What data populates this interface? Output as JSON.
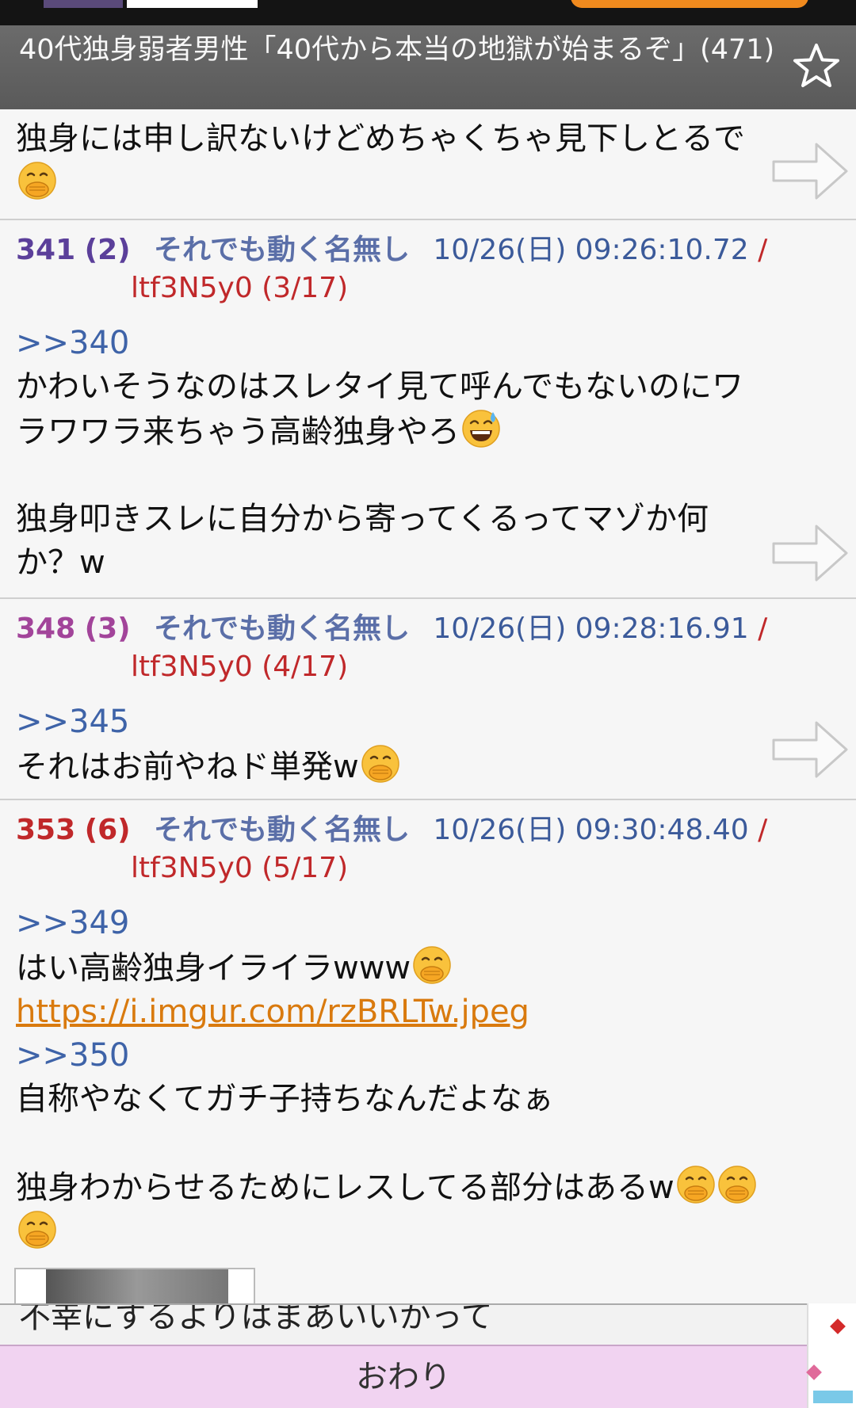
{
  "thread": {
    "title": "40代独身弱者男性「40代から本当の地獄が始まるぞ」(471)"
  },
  "partial_post": {
    "lines": [
      "独身には申し訳ないけどめちゃくちゃ見下しとるで"
    ]
  },
  "posts": [
    {
      "number": "341",
      "count": "(2)",
      "name": "それでも動く名無し",
      "date": "10/26(日) 09:26:10.72",
      "slash": "/",
      "id": "ltf3N5y0 (3/17)",
      "anchor": ">>340",
      "lines": [
        "かわいそうなのはスレタイ見て呼んでもないのにワ",
        "ラワワラ来ちゃう高齢独身やろ",
        "独身叩きスレに自分から寄ってくるってマゾか何",
        "か？w"
      ]
    },
    {
      "number": "348",
      "count": "(3)",
      "name": "それでも動く名無し",
      "date": "10/26(日) 09:28:16.91",
      "slash": "/",
      "id": "ltf3N5y0 (4/17)",
      "anchor": ">>345",
      "lines": [
        "それはお前やねド単発w"
      ]
    },
    {
      "number": "353",
      "count": "(6)",
      "name": "それでも動く名無し",
      "date": "10/26(日) 09:30:48.40",
      "slash": "/",
      "id": "ltf3N5y0 (5/17)",
      "anchor": ">>349",
      "lines": [
        "はい高齢独身イライラwww"
      ],
      "link": "https://i.imgur.com/rzBRLTw.jpeg",
      "anchor2": ">>350",
      "lines2": [
        "自称やなくてガチ子持ちなんだよなぁ",
        "独身わからせるためにレスしてる部分はあるw"
      ]
    }
  ],
  "peek_text": "不幸にするよりはまあいいかって",
  "footer": {
    "end_label": "おわり"
  },
  "colors": {
    "accent_link": "#d97a0e",
    "id_red": "#c0282a",
    "name_blue": "#5b6fa8",
    "footer_bg": "#f1d3f1"
  }
}
